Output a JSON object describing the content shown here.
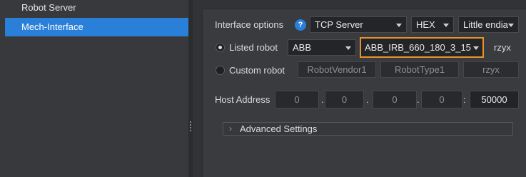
{
  "sidebar": {
    "items": [
      {
        "label": "Robot Server",
        "active": false
      },
      {
        "label": "Mech-Interface",
        "active": true
      }
    ]
  },
  "interface": {
    "label": "Interface options",
    "help_icon": "?",
    "protocol": "TCP Server",
    "encoding": "HEX",
    "byte_order": "Little endia"
  },
  "listed_robot": {
    "label": "Listed robot",
    "selected": true,
    "vendor": "ABB",
    "model": "ABB_IRB_660_180_3_15",
    "euler": "rzyx"
  },
  "custom_robot": {
    "label": "Custom robot",
    "selected": false,
    "vendor_placeholder": "RobotVendor1",
    "type_placeholder": "RobotType1",
    "euler_placeholder": "rzyx"
  },
  "host": {
    "label": "Host Address",
    "ip": [
      "0",
      "0",
      "0",
      "0"
    ],
    "dot": ".",
    "colon": ":",
    "port": "50000"
  },
  "advanced": {
    "label": "Advanced Settings",
    "chevron": "›"
  },
  "colors": {
    "accent": "#2a7fd8",
    "focus": "#e8932a"
  }
}
